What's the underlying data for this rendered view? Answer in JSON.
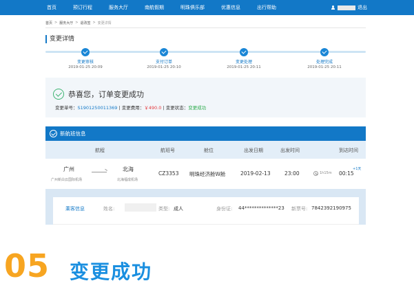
{
  "nav": {
    "items": [
      "首页",
      "预订行程",
      "服务大厅",
      "南航假期",
      "明珠俱乐部",
      "优惠信息",
      "出行帮助"
    ],
    "logout": "退出"
  },
  "breadcrumb": [
    "首页",
    "服务大厅",
    "退改签",
    "变更详情"
  ],
  "page_title": "变更详情",
  "steps": [
    {
      "label": "变更审核",
      "time": "2019-01-25 20:09"
    },
    {
      "label": "支付订单",
      "time": "2019-01-25 20:10"
    },
    {
      "label": "变更处理",
      "time": "2019-01-25 20:11"
    },
    {
      "label": "处理完成",
      "time": "2019-01-25 20:11"
    }
  ],
  "success": {
    "title": "恭喜您，订单变更成功",
    "order_label": "变更单号：",
    "order_no": "S1901250011369",
    "fee_label": "变更费用：",
    "fee": "￥490.0",
    "status_label": "变更状态：",
    "status": "变更成功",
    "separator": "|"
  },
  "flight": {
    "section_title": "新航班信息",
    "columns": [
      "航程",
      "航班号",
      "舱位",
      "出发日期",
      "出发时间",
      "到达时间"
    ],
    "from_city": "广州",
    "from_airport": "广州新白云国际机场",
    "to_city": "北海",
    "to_airport": "北海福成机场",
    "flight_no": "CZ3353",
    "cabin": "明珠经济舱W舱",
    "dep_date": "2019-02-13",
    "dep_time": "23:00",
    "duration": "1h15m",
    "arr_time": "00:15",
    "plus_day": "+1天"
  },
  "passenger": {
    "section_label": "乘客信息",
    "name_label": "姓名:",
    "type_label": "类型:",
    "type_value": "成人",
    "id_label": "身份证:",
    "id_value": "44**************23",
    "ticket_label": "新票号:",
    "ticket_value": "7842392190975"
  },
  "caption": {
    "number": "05",
    "title": "变更成功"
  },
  "colors": {
    "brand_blue": "#1278c7",
    "success_green": "#3cb371",
    "fee_red": "#e4393c",
    "caption_orange": "#f7a521",
    "caption_blue": "#1a8fe0"
  }
}
